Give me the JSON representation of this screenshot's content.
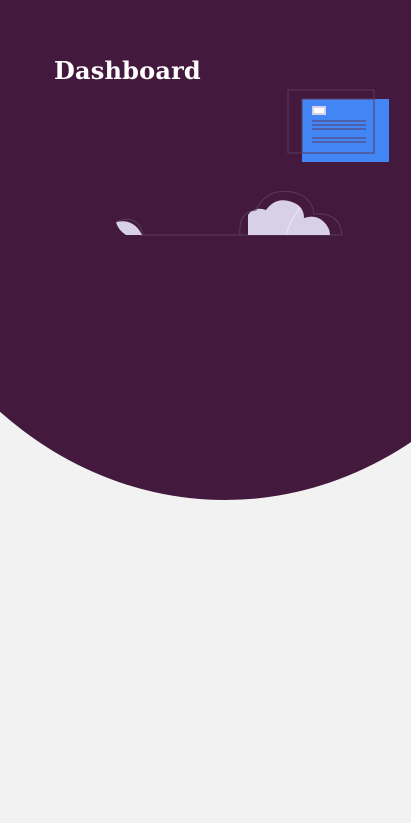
{
  "header": {
    "title": "Dashboard"
  },
  "illustration": {
    "name": "dashboard-illustration",
    "objects": [
      "document-card-icon",
      "plant-leaf-icon",
      "cloud-bush-icon"
    ]
  },
  "colors": {
    "background": "#f2f2f2",
    "hero": "#431a3e",
    "title_text": "#ffffff",
    "card_accent": "#4285f4",
    "foliage": "#d8d0e6",
    "outline": "#5a3a5e"
  }
}
